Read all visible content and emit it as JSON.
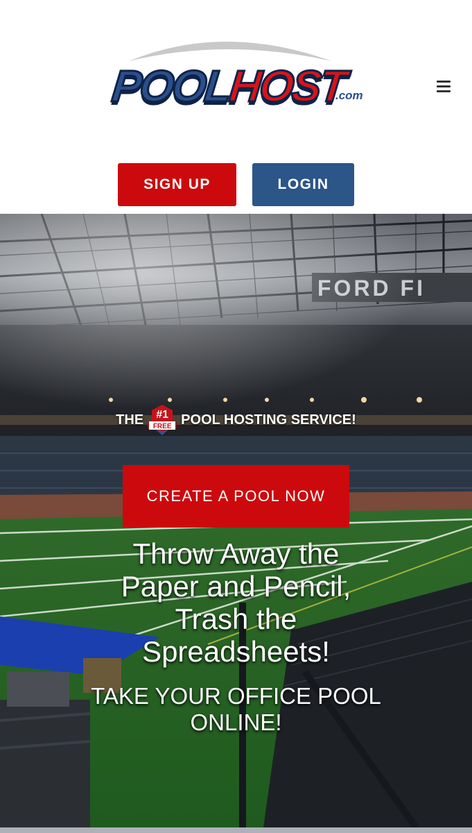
{
  "header": {
    "logo": {
      "pool": "POOL",
      "host": "HOST",
      "dotcom": ".com"
    },
    "menu_icon": "hamburger-menu-icon",
    "signup_label": "SIGN UP",
    "login_label": "LOGIN"
  },
  "hero": {
    "tagline_pre": "THE",
    "badge_number": "#1",
    "badge_free": "FREE",
    "tagline_post": "POOL HOSTING SERVICE!",
    "cta_label": "CREATE A POOL NOW",
    "headline": "Throw Away the Paper and Pencil, Trash the Spreadsheets!",
    "subheadline": "TAKE YOUR OFFICE POOL ONLINE!",
    "stadium_sign": "FORD FI"
  },
  "colors": {
    "signup": "#cc0a0d",
    "login": "#2c5588",
    "cta": "#cc0a0d",
    "logo_blue": "#2b4f8c",
    "logo_red": "#d7141a"
  }
}
